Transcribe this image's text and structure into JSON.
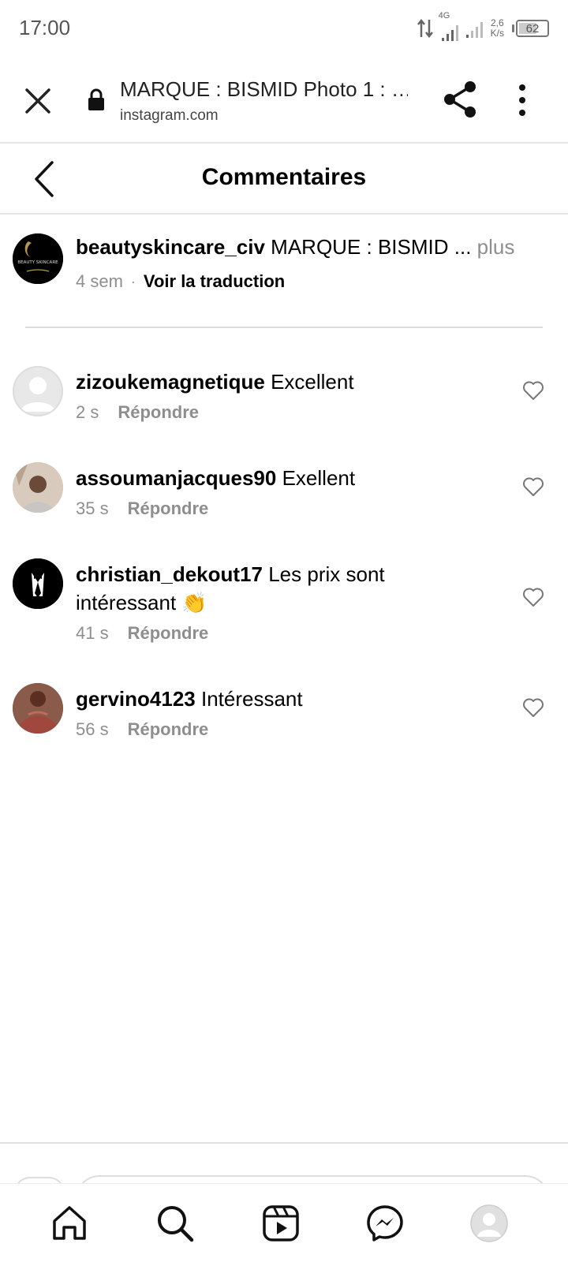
{
  "status_bar": {
    "time": "17:00",
    "network_type": "4G",
    "speed_value": "2,6",
    "speed_unit": "K/s",
    "battery": "62"
  },
  "browser": {
    "title": "MARQUE : BISMID Photo 1 : …",
    "url": "instagram.com",
    "icons": [
      "close-icon",
      "lock-icon",
      "share-icon",
      "more-vertical-icon"
    ]
  },
  "header": {
    "title": "Commentaires"
  },
  "caption": {
    "username": "beautyskincare_civ",
    "text": "MARQUE : BISMID ...",
    "more": "plus",
    "time": "4 sem",
    "separator": "·",
    "translate": "Voir la traduction",
    "avatar_text": "BEAUTY SKINCARE"
  },
  "comments": [
    {
      "username": "zizoukemagnetique",
      "text": "Excellent",
      "time": "2 s",
      "reply": "Répondre"
    },
    {
      "username": "assoumanjacques90",
      "text": "Exellent",
      "time": "35 s",
      "reply": "Répondre"
    },
    {
      "username": "christian_dekout17",
      "text": "Les prix sont intéressant 👏",
      "time": "41 s",
      "reply": "Répondre"
    },
    {
      "username": "gervino4123",
      "text": "Intéressant",
      "time": "56 s",
      "reply": "Répondre"
    }
  ],
  "bottom_nav": {
    "items": [
      "home-icon",
      "search-icon",
      "reels-icon",
      "messenger-icon",
      "profile-avatar"
    ]
  },
  "colors": {
    "secondary_text": "#8e8e8e",
    "divider": "#e6e6e6",
    "primary_text": "#000000"
  }
}
